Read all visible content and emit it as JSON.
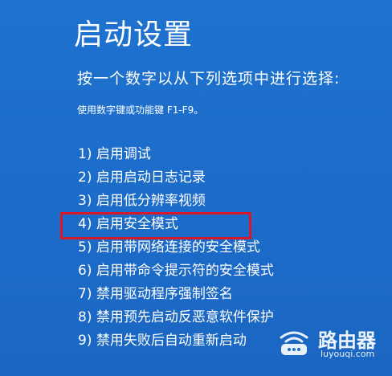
{
  "screen": {
    "title": "启动设置",
    "prompt": "按一个数字以从下列选项中进行选择:",
    "hint": "使用数字键或功能键 F1-F9。",
    "options": [
      "1) 启用调试",
      "2) 启用启动日志记录",
      "3) 启用低分辨率视频",
      "4) 启用安全模式",
      "5) 启用带网络连接的安全模式",
      "6) 启用带命令提示符的安全模式",
      "7) 禁用驱动程序强制签名",
      "8) 禁用预先启动反恶意软件保护",
      "9) 禁用失败后自动重新启动"
    ],
    "highlighted_option": "4) 启用安全模式",
    "highlight_color": "#d7182a",
    "background_color": "#1c6cca"
  },
  "watermark": {
    "name": "路由器",
    "url": "luyouqi.com",
    "logo_icon": "router-logo-icon"
  }
}
